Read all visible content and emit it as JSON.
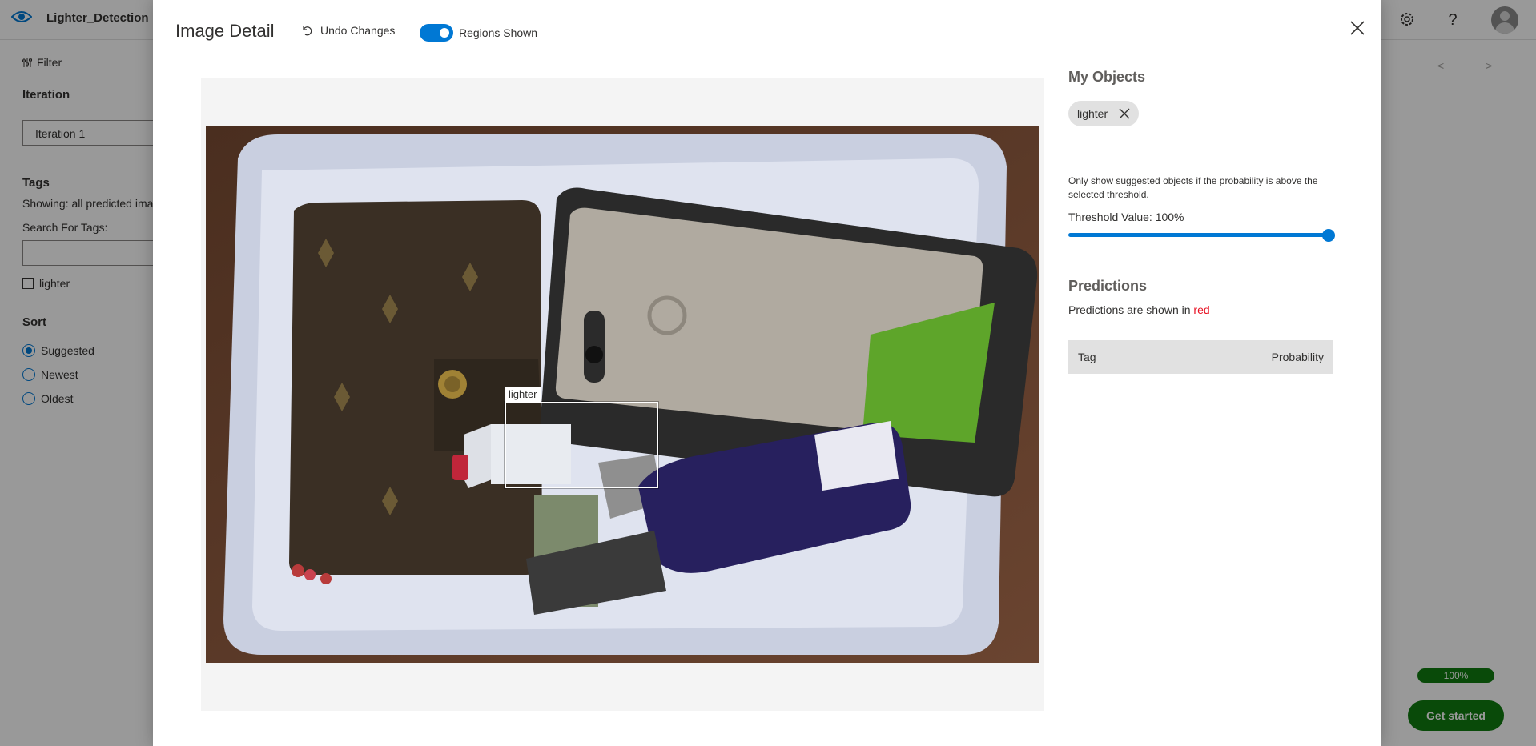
{
  "app": {
    "project_name": "Lighter_Detection",
    "filter_label": "Filter",
    "iteration_heading": "Iteration",
    "iteration_value": "Iteration 1",
    "tags_heading": "Tags",
    "tags_showing": "Showing: all predicted ima",
    "search_tags_label": "Search For Tags:",
    "tag_items": [
      "lighter"
    ],
    "sort_heading": "Sort",
    "sort_options": [
      {
        "label": "Suggested",
        "selected": true
      },
      {
        "label": "Newest",
        "selected": false
      },
      {
        "label": "Oldest",
        "selected": false
      }
    ],
    "pager_prev": "<",
    "pager_next": ">",
    "progress_percent_label": "100%",
    "progress_value": 1.0,
    "get_started_label": "Get started",
    "header_icons": [
      "gear-icon",
      "help-icon",
      "avatar"
    ]
  },
  "modal": {
    "title": "Image Detail",
    "undo_label": "Undo Changes",
    "regions_toggle_label": "Regions Shown",
    "regions_toggle_on": true,
    "image": {
      "region_tag": "lighter"
    },
    "my_objects_heading": "My Objects",
    "object_chips": [
      "lighter"
    ],
    "threshold_help": "Only show suggested objects if the probability is above the selected threshold.",
    "threshold_label": "Threshold Value: 100%",
    "threshold_value": 1.0,
    "predictions_heading": "Predictions",
    "predictions_note_prefix": "Predictions are shown in ",
    "predictions_note_color_word": "red",
    "predictions_columns": [
      "Tag",
      "Probability"
    ],
    "colors": {
      "accent": "#0078d4",
      "prediction": "#e81123",
      "success": "#107c10"
    }
  }
}
